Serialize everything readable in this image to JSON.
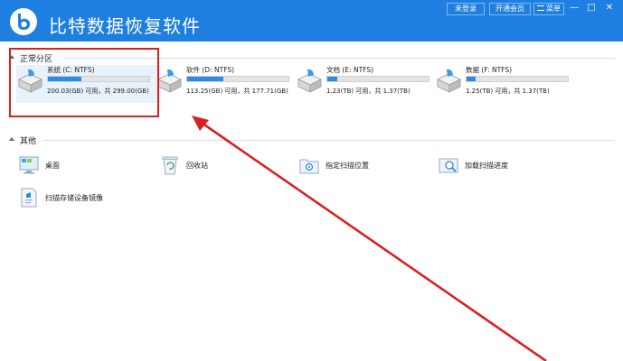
{
  "app": {
    "title": "比特数据恢复软件",
    "buttons": {
      "login": "未登录",
      "vip": "开通会员",
      "menu": "菜单"
    },
    "window_controls": {
      "minimize": "—",
      "maximize": "□",
      "close": "✕"
    }
  },
  "sections": {
    "partitions": {
      "title": "正常分区"
    },
    "other": {
      "title": "其他"
    }
  },
  "drives": [
    {
      "name": "系统 (C: NTFS)",
      "capacity": "200.03(GB) 可用，共 299.00(GB)",
      "used_fraction": 0.33,
      "selected": true
    },
    {
      "name": "软件 (D: NTFS)",
      "capacity": "113.25(GB) 可用，共 177.71(GB)",
      "used_fraction": 0.36,
      "selected": false
    },
    {
      "name": "文档 (E: NTFS)",
      "capacity": "1.23(TB) 可用，共 1.37(TB)",
      "used_fraction": 0.1,
      "selected": false
    },
    {
      "name": "数据 (F: NTFS)",
      "capacity": "1.25(TB) 可用，共 1.37(TB)",
      "used_fraction": 0.09,
      "selected": false
    }
  ],
  "tools": [
    {
      "label": "桌面",
      "icon": "desktop-icon"
    },
    {
      "label": "回收站",
      "icon": "recycle-bin-icon"
    },
    {
      "label": "指定扫描位置",
      "icon": "scan-location-icon"
    },
    {
      "label": "加载扫描进度",
      "icon": "load-progress-icon"
    },
    {
      "label": "扫描存储设备镜像",
      "icon": "device-image-icon"
    }
  ],
  "colors": {
    "titlebar": "#1e7fe0",
    "bar_fill": "#2b8be6",
    "annotation": "#d92020"
  }
}
